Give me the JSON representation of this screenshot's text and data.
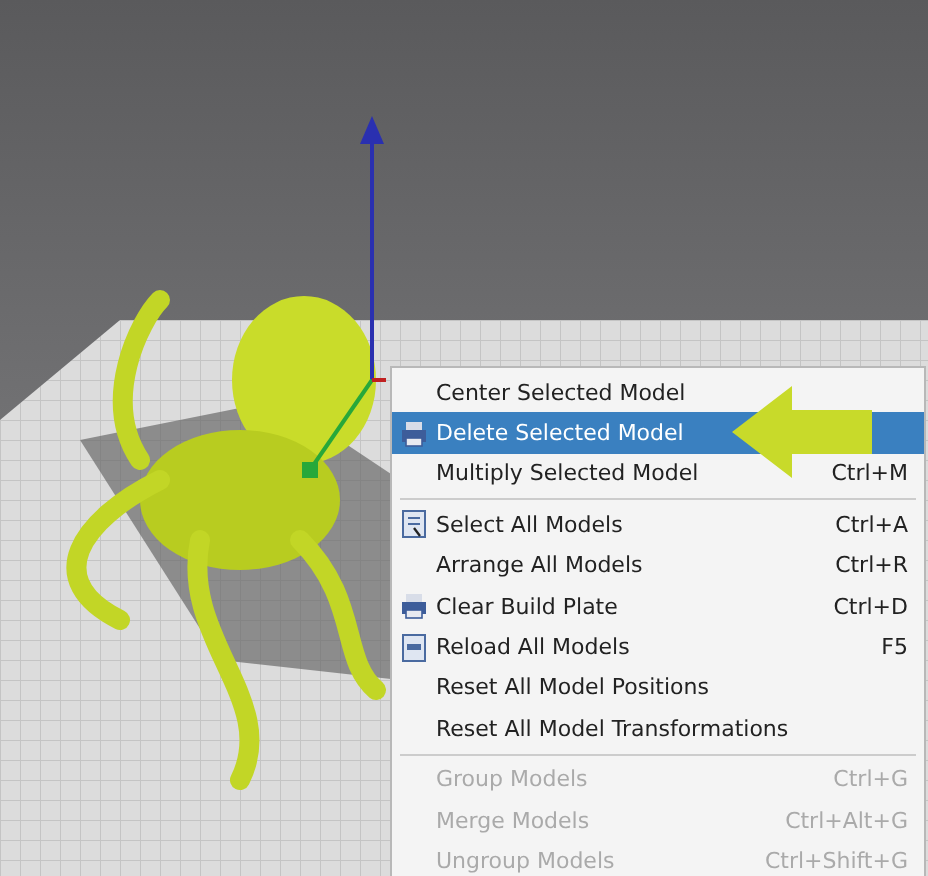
{
  "context_menu": {
    "items": [
      {
        "kind": "item",
        "label": "Center Selected Model",
        "selected": false,
        "disabled": false
      },
      {
        "kind": "item",
        "label": "Delete Selected Model",
        "selected": true,
        "disabled": false
      },
      {
        "kind": "item",
        "label": "Multiply Selected Model",
        "shortcut": "Ctrl+M",
        "selected": false,
        "disabled": false
      },
      {
        "kind": "separator"
      },
      {
        "kind": "item",
        "label": "Select All Models",
        "shortcut": "Ctrl+A",
        "selected": false,
        "disabled": false
      },
      {
        "kind": "item",
        "label": "Arrange All Models",
        "shortcut": "Ctrl+R",
        "selected": false,
        "disabled": false
      },
      {
        "kind": "item",
        "label": "Clear Build Plate",
        "shortcut": "Ctrl+D",
        "selected": false,
        "disabled": false
      },
      {
        "kind": "item",
        "label": "Reload All Models",
        "shortcut": "F5",
        "selected": false,
        "disabled": false
      },
      {
        "kind": "item",
        "label": "Reset All Model Positions",
        "selected": false,
        "disabled": false
      },
      {
        "kind": "item",
        "label": "Reset All Model Transformations",
        "selected": false,
        "disabled": false
      },
      {
        "kind": "separator"
      },
      {
        "kind": "item",
        "label": "Group Models",
        "shortcut": "Ctrl+G",
        "selected": false,
        "disabled": true
      },
      {
        "kind": "item",
        "label": "Merge Models",
        "shortcut": "Ctrl+Alt+G",
        "selected": false,
        "disabled": true
      },
      {
        "kind": "item",
        "label": "Ungroup Models",
        "shortcut": "Ctrl+Shift+G",
        "selected": false,
        "disabled": true
      }
    ]
  }
}
